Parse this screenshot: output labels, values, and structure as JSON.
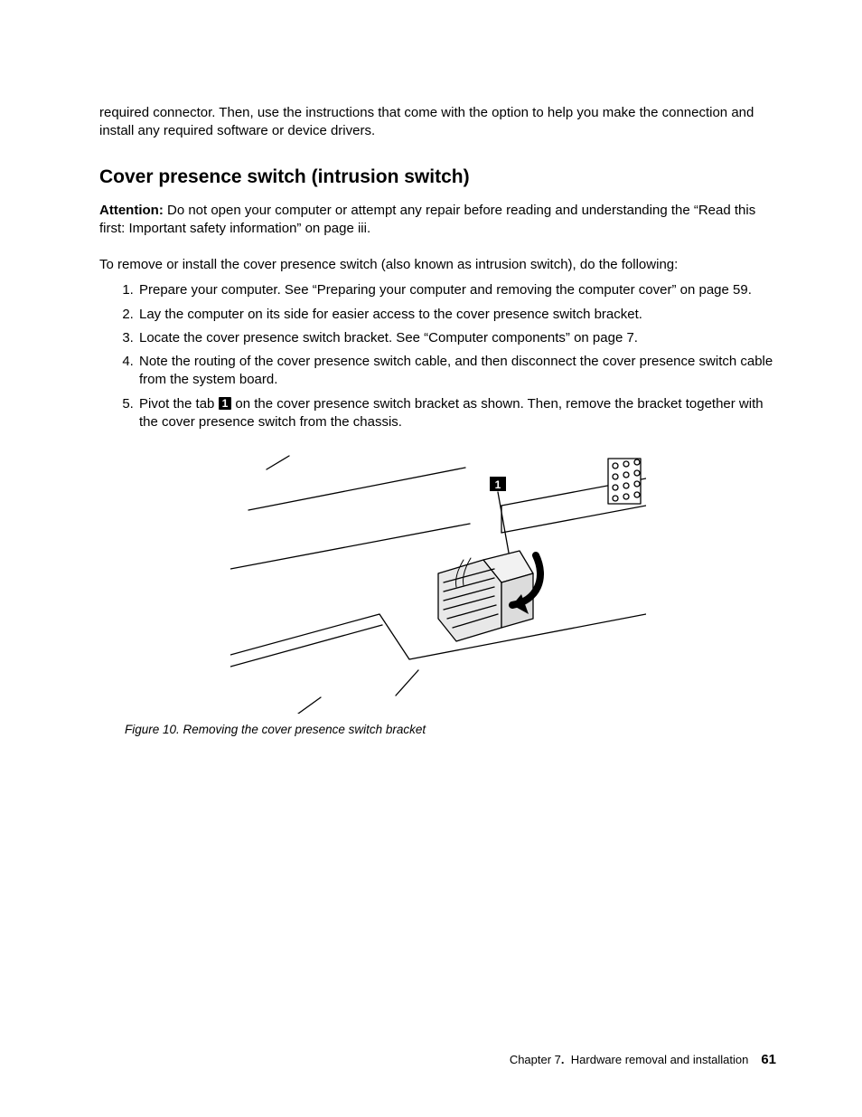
{
  "intro_paragraph": "required connector. Then, use the instructions that come with the option to help you make the connection and install any required software or device drivers.",
  "section_heading": "Cover presence switch (intrusion switch)",
  "attention_label": "Attention:",
  "attention_text": " Do not open your computer or attempt any repair before reading and understanding the “Read this first: Important safety information” on page iii.",
  "lead_text": "To remove or install the cover presence switch (also known as intrusion switch), do the following:",
  "steps": {
    "s1": "Prepare your computer. See “Preparing your computer and removing the computer cover” on page 59.",
    "s2": "Lay the computer on its side for easier access to the cover presence switch bracket.",
    "s3": "Locate the cover presence switch bracket. See “Computer components” on page 7.",
    "s4": "Note the routing of the cover presence switch cable, and then disconnect the cover presence switch cable from the system board.",
    "s5_a": "Pivot the tab ",
    "s5_callout": "1",
    "s5_b": " on the cover presence switch bracket as shown. Then, remove the bracket together with the cover presence switch from the chassis."
  },
  "figure": {
    "callout_label": "1",
    "caption": "Figure 10. Removing the cover presence switch bracket"
  },
  "footer": {
    "chapter": "Chapter 7",
    "title": "Hardware removal and installation",
    "page": "61"
  }
}
